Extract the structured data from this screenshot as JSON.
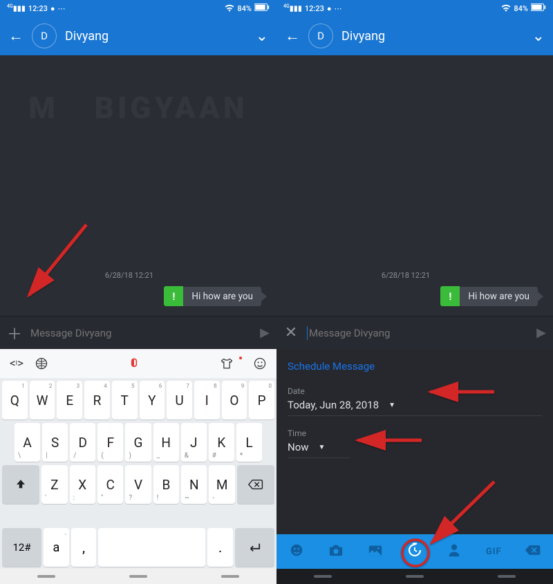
{
  "status": {
    "signal_label": "4G",
    "time": "12:23",
    "wifi_icon": "wifi",
    "battery_pct": "84%"
  },
  "header": {
    "avatar_initial": "D",
    "contact_name": "Divyang"
  },
  "chat": {
    "watermark_left": "M",
    "watermark_right": "BIGYAAN",
    "timestamp": "6/28/18 12:21",
    "message_status": "!",
    "message_text": "Hi how are you"
  },
  "input": {
    "placeholder": "Message Divyang"
  },
  "keyboard": {
    "row1": [
      {
        "main": "Q",
        "sub": "1"
      },
      {
        "main": "W",
        "sub": "2"
      },
      {
        "main": "E",
        "sub": "3"
      },
      {
        "main": "R",
        "sub": "4"
      },
      {
        "main": "T",
        "sub": "5"
      },
      {
        "main": "Y",
        "sub": "6"
      },
      {
        "main": "U",
        "sub": "7"
      },
      {
        "main": "I",
        "sub": "8"
      },
      {
        "main": "O",
        "sub": "9"
      },
      {
        "main": "P",
        "sub": "0"
      }
    ],
    "row2": [
      {
        "main": "A",
        "subbl": "\\"
      },
      {
        "main": "S",
        "subbl": "|"
      },
      {
        "main": "D",
        "subbl": "/"
      },
      {
        "main": "F",
        "subbl": "("
      },
      {
        "main": "G",
        "subbl": ")"
      },
      {
        "main": "H",
        "subbl": "_"
      },
      {
        "main": "J",
        "subbl": "&"
      },
      {
        "main": "K",
        "subbl": "#"
      },
      {
        "main": "L",
        "subbl": "*"
      }
    ],
    "row3": [
      {
        "main": "Z",
        "subbl": "'"
      },
      {
        "main": "X",
        "subbl": ":"
      },
      {
        "main": "C",
        "subbl": "\""
      },
      {
        "main": "V",
        "subbl": "?"
      },
      {
        "main": "B",
        "subbl": "!"
      },
      {
        "main": "N",
        "subbl": "~"
      },
      {
        "main": "M",
        "subbl": "-"
      }
    ],
    "num_key": "12#",
    "a_key": "a",
    "comma": ",",
    "dot": "."
  },
  "schedule": {
    "title": "Schedule Message",
    "date_label": "Date",
    "date_value": "Today, Jun 28, 2018",
    "time_label": "Time",
    "time_value": "Now"
  },
  "bottom_tools": {
    "gif": "GIF"
  }
}
